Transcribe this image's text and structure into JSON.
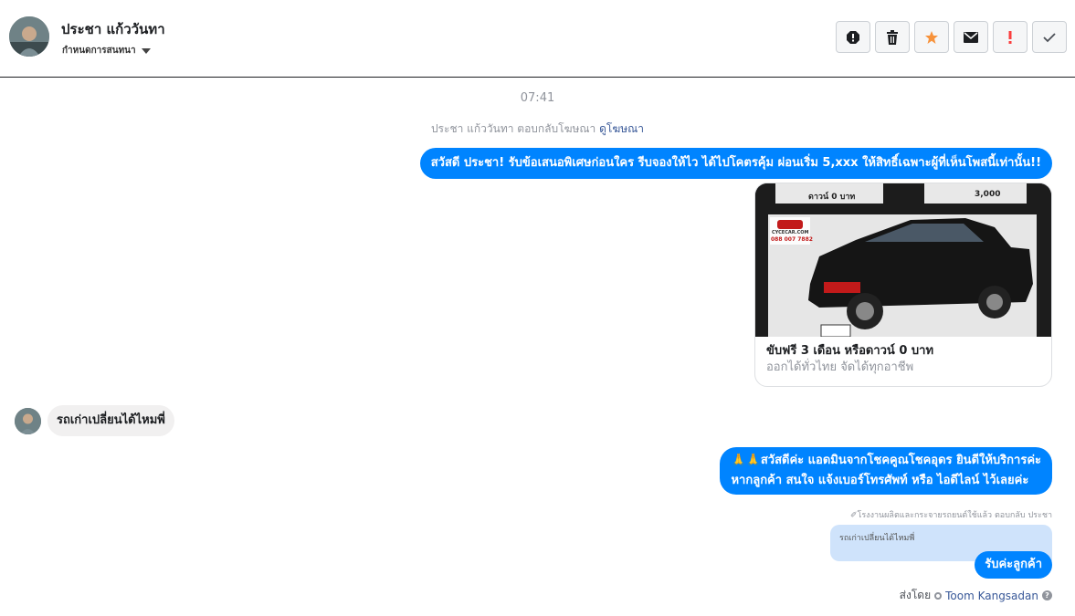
{
  "header": {
    "contact_name": "ประชา แก้ววันทา",
    "assign_label": "กำหนดการสนทนา",
    "toolbar": [
      "spam-icon",
      "trash-icon",
      "star-icon",
      "mail-icon",
      "important-icon",
      "check-icon"
    ],
    "star_color": "#f7923b",
    "important_color": "#fa3e3e"
  },
  "thread": {
    "time": "07:41",
    "replied_prefix": "ประชา แก้ววันทา ตอบกลับโฆษณา",
    "replied_link": "ดูโฆษณา",
    "msg1": "สวัสดี ประชา! รับข้อเสนอพิเศษก่อนใคร รีบจองให้ไว ได้ไปโคตรคุ้ม ผ่อนเริ่ม 5,xxx  ให้สิทธิ์เฉพาะผู้ที่เห็นโพสนี้เท่านั้น!!",
    "card": {
      "title": "ขับฟรี 3 เดือน หรือดาวน์ 0 บาท",
      "subtitle": "ออกได้ทั่วไทย จัดได้ทุกอาชีพ",
      "img_text_1": "ดาวน์ 0 บาท",
      "img_text_2": "3,000",
      "img_logo": "CYCECAR.COM",
      "img_phone": "088 007 7882"
    },
    "msg2": "รถเก่าเปลี่ยนได้ไหมพี่",
    "msg3_line1": "🙏🙏สวัสดีค่ะ แอดมินจากโชคคูณโชคอุดร ยินดีให้บริการค่ะ",
    "msg3_line2": "หากลูกค้า สนใจ แจ้งเบอร์โทรศัพท์ หรือ ไอดีไลน์  ไว้เลยค่ะ",
    "context_note": "โรงงานผลิตและกระจายรถยนต์ใช้แล้ว ตอบกลับ ประชา",
    "quoted_text": "รถเก่าเปลี่ยนได้ไหมพี่",
    "msg4": "รับค่ะลูกค้า",
    "sent_by_label": "ส่งโดย",
    "sent_by_name": "Toom Kangsadan",
    "accent": "#0084ff"
  }
}
